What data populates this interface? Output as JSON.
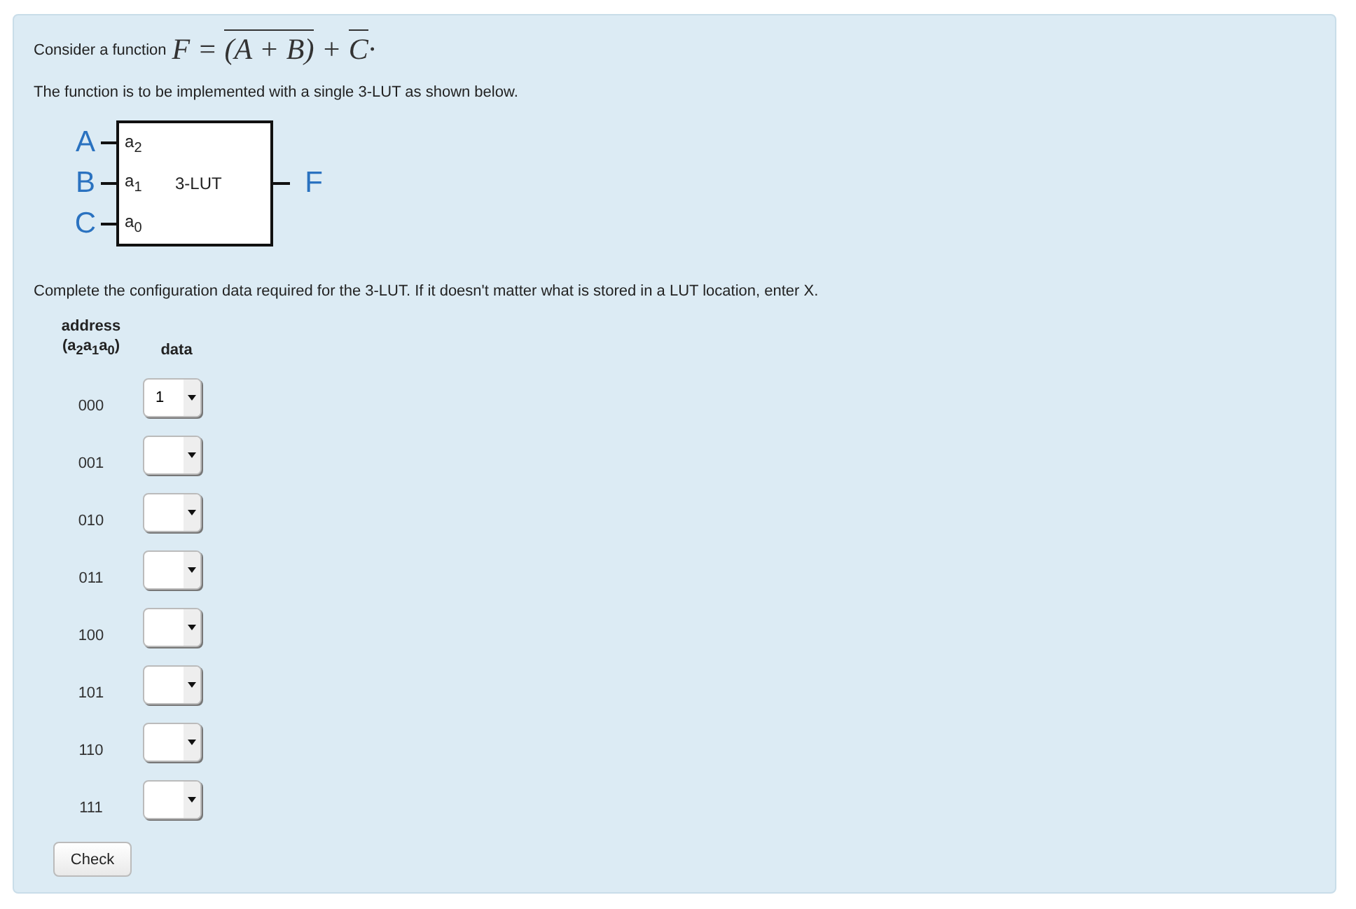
{
  "intro": "Consider a function",
  "formula": [
    {
      "text": "F = ",
      "overline": false
    },
    {
      "text": "(A + B)",
      "overline": true
    },
    {
      "text": " + ",
      "overline": false
    },
    {
      "text": "C",
      "overline": true
    },
    {
      "text": "·",
      "overline": false
    }
  ],
  "description": "The function is to be implemented with a single 3-LUT as shown below.",
  "diagram": {
    "inputs": [
      {
        "signal": "A",
        "port": "a$_{2}$"
      },
      {
        "signal": "B",
        "port": "a$_{1}$"
      },
      {
        "signal": "C",
        "port": "a$_{0}$"
      }
    ],
    "block_label": "3-LUT",
    "output": "F"
  },
  "instruction": "Complete the configuration data required for the 3-LUT. If it doesn't matter what is stored in a LUT location, enter X.",
  "table": {
    "address_header": [
      "address",
      "(a$_{2}$a$_{1}$a$_{0}$)"
    ],
    "data_header": "data",
    "rows": [
      {
        "address": "000",
        "value": "1"
      },
      {
        "address": "001"
      },
      {
        "address": "010"
      },
      {
        "address": "011"
      },
      {
        "address": "100"
      },
      {
        "address": "101"
      },
      {
        "address": "110"
      },
      {
        "address": "111"
      }
    ]
  },
  "check_button": "Check"
}
